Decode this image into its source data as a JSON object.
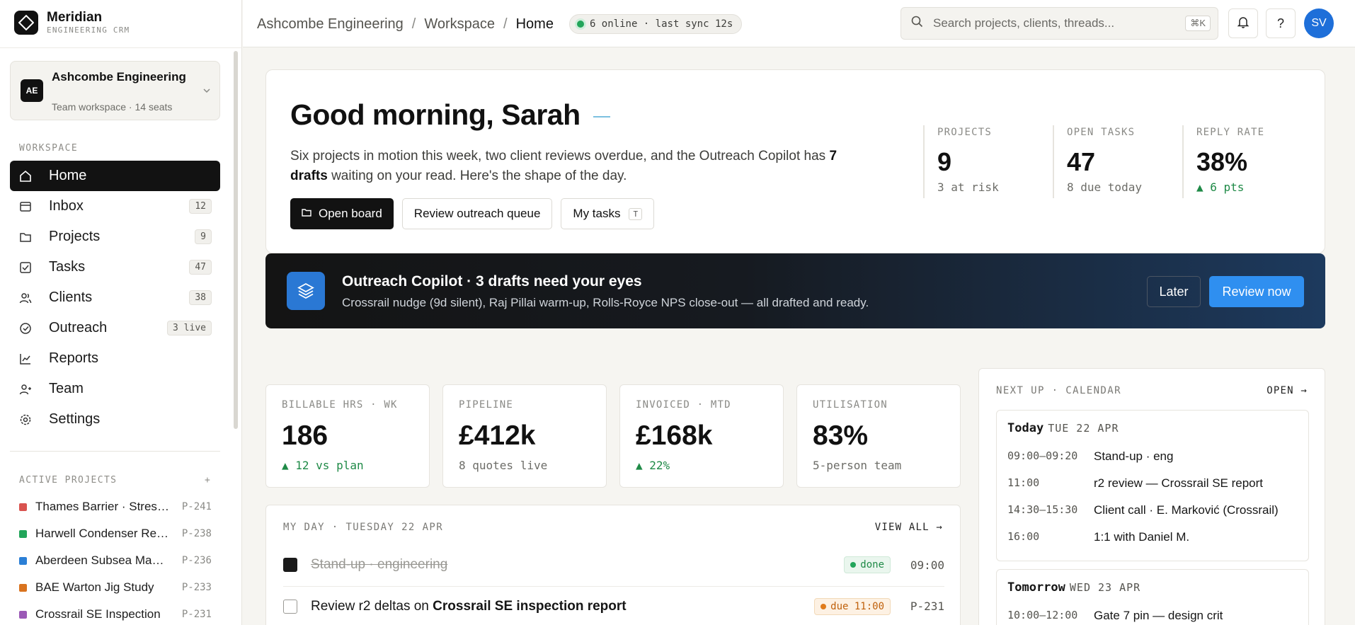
{
  "brand": {
    "name": "Meridian",
    "sub": "ENGINEERING CRM"
  },
  "workspace": {
    "avatar": "AE",
    "name": "Ashcombe Engineering",
    "meta": "Team workspace · 14 seats"
  },
  "sidebar": {
    "section_workspace": "WORKSPACE",
    "items": [
      {
        "label": "Home",
        "icon": "home-icon",
        "badge": ""
      },
      {
        "label": "Inbox",
        "icon": "inbox-icon",
        "badge": "12"
      },
      {
        "label": "Projects",
        "icon": "folder-icon",
        "badge": "9"
      },
      {
        "label": "Tasks",
        "icon": "check-square-icon",
        "badge": "47"
      },
      {
        "label": "Clients",
        "icon": "users-icon",
        "badge": "38"
      },
      {
        "label": "Outreach",
        "icon": "check-circle-icon",
        "badge": "3 live"
      },
      {
        "label": "Reports",
        "icon": "chart-icon",
        "badge": ""
      },
      {
        "label": "Team",
        "icon": "team-icon",
        "badge": ""
      },
      {
        "label": "Settings",
        "icon": "gear-icon",
        "badge": ""
      }
    ],
    "section_projects": "ACTIVE PROJECTS",
    "add": "+",
    "projects": [
      {
        "name": "Thames Barrier · Stress test",
        "code": "P-241",
        "color": "#d9534f"
      },
      {
        "name": "Harwell Condenser Retrofit",
        "code": "P-238",
        "color": "#22a55a"
      },
      {
        "name": "Aberdeen Subsea Manifold",
        "code": "P-236",
        "color": "#2b7fd6"
      },
      {
        "name": "BAE Warton Jig Study",
        "code": "P-233",
        "color": "#d9731f"
      },
      {
        "name": "Crossrail SE Inspection",
        "code": "P-231",
        "color": "#9b59b6"
      }
    ]
  },
  "topbar": {
    "crumbs": [
      "Ashcombe Engineering",
      "Workspace",
      "Home"
    ],
    "sync": "6 online · last sync 12s",
    "search_placeholder": "Search projects, clients, threads...",
    "search_kbd": "⌘K",
    "help": "?",
    "avatar": "SV"
  },
  "hero": {
    "greeting": "Good morning, Sarah",
    "desc_pre": "Six projects in motion this week, two client reviews overdue, and the Outreach Copilot has ",
    "desc_bold": "7 drafts",
    "desc_post": " waiting on your read. Here's the shape of the day.",
    "btn_board": "Open board",
    "btn_queue": "Review outreach queue",
    "btn_tasks": "My tasks",
    "btn_tasks_kbd": "T",
    "stats": [
      {
        "label": "PROJECTS",
        "value": "9",
        "sub": "3 at risk",
        "up": false
      },
      {
        "label": "OPEN TASKS",
        "value": "47",
        "sub": "8 due today",
        "up": false
      },
      {
        "label": "REPLY RATE",
        "value": "38%",
        "sub": "▲ 6 pts",
        "up": true
      }
    ]
  },
  "copilot": {
    "title": "Outreach Copilot · 3 drafts need your eyes",
    "desc": "Crossrail nudge (9d silent), Raj Pillai warm-up, Rolls-Royce NPS close-out — all drafted and ready.",
    "later": "Later",
    "review": "Review now"
  },
  "kpis": [
    {
      "label": "BILLABLE HRS · WK",
      "value": "186",
      "sub": "▲ 12 vs plan",
      "up": true
    },
    {
      "label": "PIPELINE",
      "value": "£412k",
      "sub": "8 quotes live",
      "up": false
    },
    {
      "label": "INVOICED · MTD",
      "value": "£168k",
      "sub": "▲ 22%",
      "up": true
    },
    {
      "label": "UTILISATION",
      "value": "83%",
      "sub": "5-person team",
      "up": false
    }
  ],
  "myday": {
    "head": "MY DAY · TUESDAY 22 APR",
    "link": "VIEW ALL →",
    "tasks": [
      {
        "title_pre": "Stand-up · engineering",
        "title_bold": "",
        "status": "done",
        "meta": "09:00",
        "done": true
      },
      {
        "title_pre": "Review r2 deltas on ",
        "title_bold": "Crossrail SE inspection report",
        "status": "due 11:00",
        "meta": "P-231",
        "done": false
      }
    ]
  },
  "calendar": {
    "head": "NEXT UP · CALENDAR",
    "link": "OPEN →",
    "today": {
      "label": "Today",
      "date": "TUE 22 APR",
      "events": [
        {
          "time": "09:00–09:20",
          "title": "Stand-up · eng"
        },
        {
          "time": "11:00",
          "title": "r2 review — Crossrail SE report"
        },
        {
          "time": "14:30–15:30",
          "title": "Client call · E. Marković (Crossrail)"
        },
        {
          "time": "16:00",
          "title": "1:1 with Daniel M."
        }
      ]
    },
    "tomorrow": {
      "label": "Tomorrow",
      "date": "WED 23 APR",
      "events": [
        {
          "time": "10:00–12:00",
          "title": "Gate 7 pin — design crit"
        }
      ]
    }
  }
}
